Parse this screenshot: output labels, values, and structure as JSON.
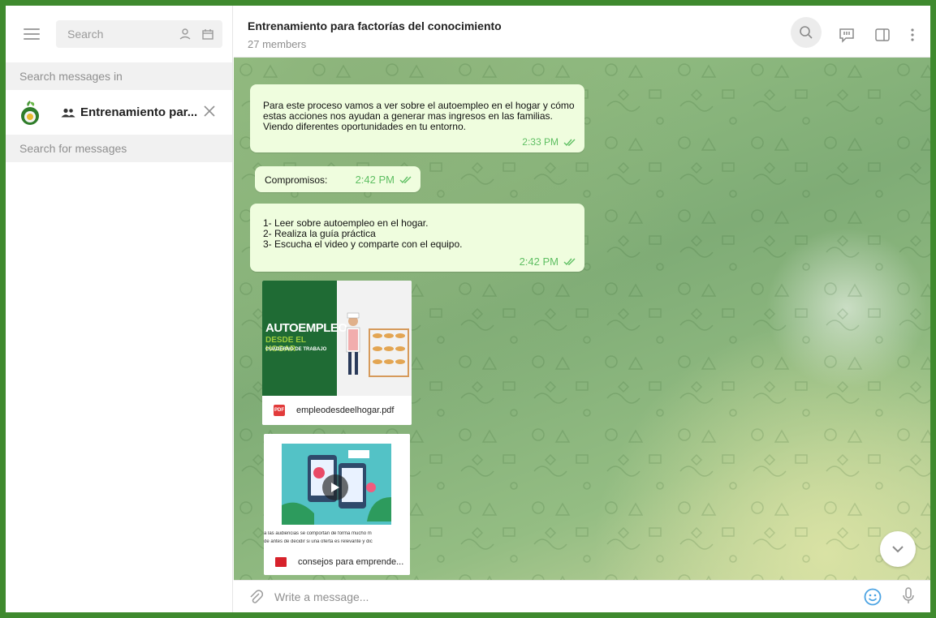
{
  "sidebar": {
    "search_placeholder": "Search",
    "search_in_label": "Search messages in",
    "chat_name": "Entrenamiento par...",
    "search_messages_placeholder": "Search for messages"
  },
  "header": {
    "title": "Entrenamiento para factorías del conocimiento",
    "subtitle": "27 members"
  },
  "messages": [
    {
      "text": "Para este proceso vamos a ver sobre el autoempleo en el hogar y cómo estas acciones nos ayudan a generar mas ingresos en las familias. Viendo diferentes oportunidades en tu entorno.",
      "time": "2:33 PM"
    },
    {
      "text": "Compromisos:",
      "time": "2:42 PM"
    },
    {
      "lines": [
        "1- Leer  sobre autoempleo en el hogar.",
        "2- Realiza la guía práctica",
        "3- Escucha el video y comparte con el equipo."
      ],
      "time": "2:42 PM"
    }
  ],
  "files": [
    {
      "type": "pdf",
      "name": "empleodesdeelhogar.pdf",
      "cover_title": "AUTOEMPLEO",
      "cover_sub": "DESDE EL HOGAR",
      "cover_sub2": "CUADERNO DE TRABAJO"
    },
    {
      "type": "video",
      "name": "consejos para emprende...",
      "caption1": "a las audiencias se comportan de forma mucho m",
      "caption2": "de antes de decidir si una oferta es relevante y dic"
    }
  ],
  "composer": {
    "placeholder": "Write a message..."
  },
  "colors": {
    "frame": "#3f8a2e",
    "bubble": "#effdde",
    "time": "#5fbf63",
    "accent": "#4ba3e3"
  }
}
